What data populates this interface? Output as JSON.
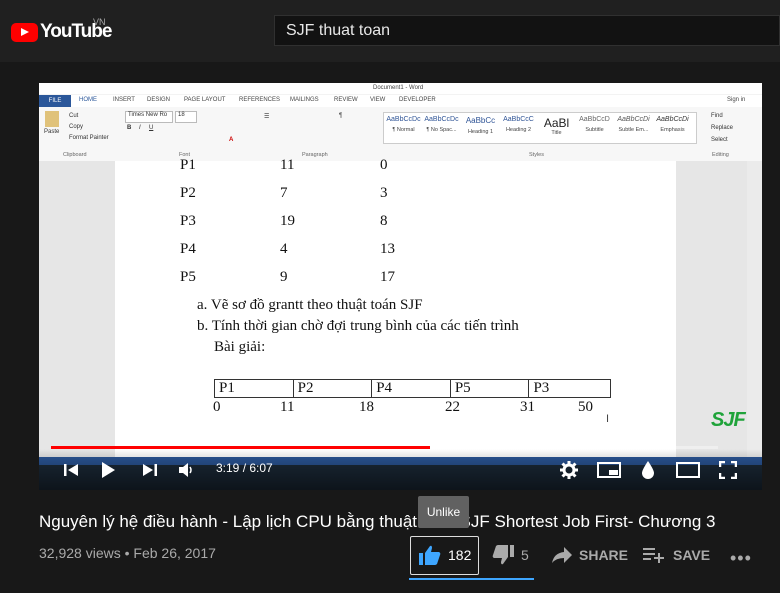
{
  "header": {
    "brand": "YouTube",
    "region": "VN",
    "search_value": "SJF thuat toan"
  },
  "word": {
    "doc_title": "Document1 - Word",
    "tabs": [
      "FILE",
      "HOME",
      "INSERT",
      "DESIGN",
      "PAGE LAYOUT",
      "REFERENCES",
      "MAILINGS",
      "REVIEW",
      "VIEW",
      "DEVELOPER"
    ],
    "sign_in": "Sign in",
    "font_name": "Times New Ro",
    "font_size": "18",
    "clipboard": [
      "Cut",
      "Copy",
      "Format Painter"
    ],
    "paste": "Paste",
    "styles": [
      {
        "sample": "AaBbCcDc",
        "name": "¶ Normal"
      },
      {
        "sample": "AaBbCcDc",
        "name": "¶ No Spac..."
      },
      {
        "sample": "AaBbCc",
        "name": "Heading 1"
      },
      {
        "sample": "AaBbCcC",
        "name": "Heading 2"
      },
      {
        "sample": "AaBl",
        "name": "Title"
      },
      {
        "sample": "AaBbCcD",
        "name": "Subtitle"
      },
      {
        "sample": "AaBbCcDi",
        "name": "Subtle Em..."
      },
      {
        "sample": "AaBbCcDi",
        "name": "Emphasis"
      }
    ],
    "editing": [
      "Find",
      "Replace",
      "Select"
    ],
    "groups": [
      "Clipboard",
      "Font",
      "Paragraph",
      "Styles",
      "Editing"
    ]
  },
  "document": {
    "rows": [
      {
        "p": "P1",
        "burst": "11",
        "arrival": "0"
      },
      {
        "p": "P2",
        "burst": "7",
        "arrival": "3"
      },
      {
        "p": "P3",
        "burst": "19",
        "arrival": "8"
      },
      {
        "p": "P4",
        "burst": "4",
        "arrival": "13"
      },
      {
        "p": "P5",
        "burst": "9",
        "arrival": "17"
      }
    ],
    "item_a": "a. Vẽ sơ đồ grantt theo thuật toán SJF",
    "item_b": "b. Tính thời gian chờ đợi trung bình của các tiến trình",
    "solution": "Bài giải:",
    "gantt": [
      "P1",
      "P2",
      "P4",
      "P5",
      "P3"
    ],
    "ticks": [
      "0",
      "11",
      "18",
      "22",
      "31",
      "50"
    ],
    "watermark": "SJF"
  },
  "player": {
    "time": "3:19 / 6:07",
    "progress": 0.568
  },
  "video": {
    "title": "Nguyên lý hệ điều hành - Lập lịch CPU bằng thuật toán SJF Shortest Job First- Chương 3",
    "views": "32,928 views",
    "date": "Feb 26, 2017",
    "meta_sep": "•"
  },
  "actions": {
    "tooltip": "Unlike",
    "likes": "182",
    "dislikes": "5",
    "share": "SHARE",
    "save": "SAVE"
  },
  "colors": {
    "brand_red": "#ff0000",
    "word_blue": "#2b579a",
    "accent_blue": "#3ea6ff"
  }
}
